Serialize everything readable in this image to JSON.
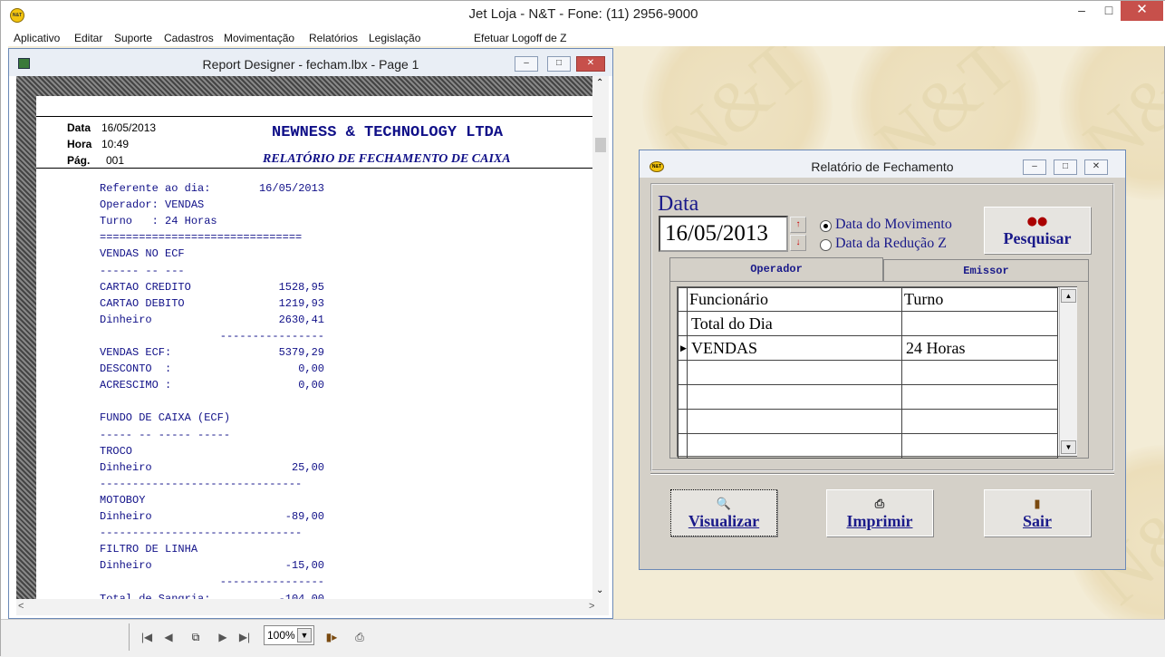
{
  "app": {
    "title": "Jet Loja - N&T - Fone: (11) 2956-9000",
    "icon_text": "N&T"
  },
  "menu": [
    "Aplicativo",
    "Editar",
    "Suporte",
    "Cadastros",
    "Movimentação",
    "Relatórios",
    "Legislação",
    "Efetuar Logoff de Z"
  ],
  "report_window": {
    "title": "Report Designer - fecham.lbx - Page 1"
  },
  "report": {
    "data_label": "Data",
    "data_value": "16/05/2013",
    "hora_label": "Hora",
    "hora_value": "10:49",
    "pag_label": "Pág.",
    "pag_value": "001",
    "company": "NEWNESS & TECHNOLOGY LTDA",
    "subtitle": "RELATÓRIO DE FECHAMENTO DE CAIXA",
    "lines": [
      [
        "Referente ao dia:",
        "16/05/2013"
      ],
      [
        "Operador: VENDAS",
        ""
      ],
      [
        "Turno   : 24 Horas",
        ""
      ],
      [
        "===============================",
        ""
      ],
      [
        "VENDAS NO ECF",
        ""
      ],
      [
        "------ -- ---",
        ""
      ],
      [
        "CARTAO CREDITO",
        "1528,95"
      ],
      [
        "CARTAO DEBITO",
        "1219,93"
      ],
      [
        "Dinheiro",
        "2630,41"
      ],
      [
        "",
        "----------------"
      ],
      [
        "VENDAS ECF:",
        "5379,29"
      ],
      [
        "DESCONTO  :",
        "0,00"
      ],
      [
        "ACRESCIMO :",
        "0,00"
      ],
      [
        "",
        ""
      ],
      [
        "FUNDO DE CAIXA (ECF)",
        ""
      ],
      [
        "----- -- ----- -----",
        ""
      ],
      [
        "TROCO",
        ""
      ],
      [
        "Dinheiro",
        "25,00"
      ],
      [
        "-------------------------------",
        ""
      ],
      [
        "MOTOBOY",
        ""
      ],
      [
        "Dinheiro",
        "-89,00"
      ],
      [
        "-------------------------------",
        ""
      ],
      [
        "FILTRO DE LINHA",
        ""
      ],
      [
        "Dinheiro",
        "-15,00"
      ],
      [
        "",
        "----------------"
      ],
      [
        "Total de Sangria:",
        "-104,00"
      ]
    ]
  },
  "toolbar": {
    "zoom": "100%"
  },
  "dialog": {
    "title": "Relatório de Fechamento",
    "icon_text": "N&T",
    "data_label": "Data",
    "date_value": "16/05/2013",
    "radio_movimento": "Data do Movimento",
    "radio_reducao": "Data da Redução Z",
    "pesquisar": "Pesquisar",
    "tab_operador": "Operador",
    "tab_emissor": "Emissor",
    "col_funcionario": "Funcionário",
    "col_turno": "Turno",
    "rows": [
      [
        "Total do Dia",
        ""
      ],
      [
        "VENDAS",
        "24 Horas"
      ]
    ],
    "visualizar": "Visualizar",
    "imprimir": "Imprimir",
    "sair": "Sair"
  },
  "seal_text": "N&T"
}
